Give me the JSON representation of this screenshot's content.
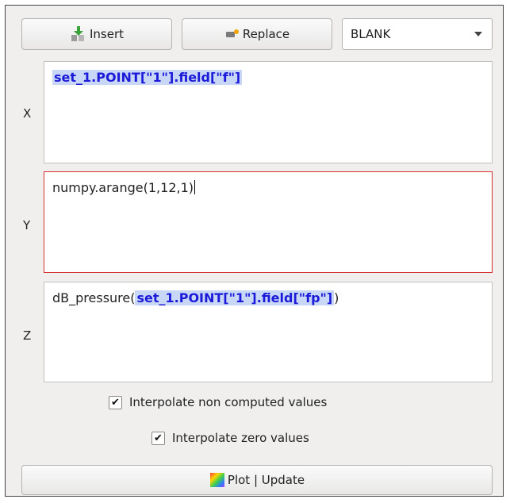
{
  "toolbar": {
    "insert_label": "Insert",
    "replace_label": "Replace",
    "source_select": "BLANK"
  },
  "fields": {
    "x": {
      "label": "X",
      "token": "set_1.POINT[\"1\"].field[\"f\"]"
    },
    "y": {
      "label": "Y",
      "text": "numpy.arange(1,12,1)"
    },
    "z": {
      "label": "Z",
      "prefix": "dB_pressure(",
      "token": "set_1.POINT[\"1\"].field[\"fp\"]",
      "suffix": ")"
    }
  },
  "options": {
    "interpolate_non_computed": {
      "label": "Interpolate non computed values",
      "checked": true,
      "mark": "✔"
    },
    "interpolate_zero": {
      "label": "Interpolate zero values",
      "checked": true,
      "mark": "✔"
    }
  },
  "plot_button": {
    "label": "Plot | Update"
  },
  "colors": {
    "token_bg": "#c9d7f7",
    "token_text": "#1a1ad8",
    "active_border": "#d32f2f"
  }
}
